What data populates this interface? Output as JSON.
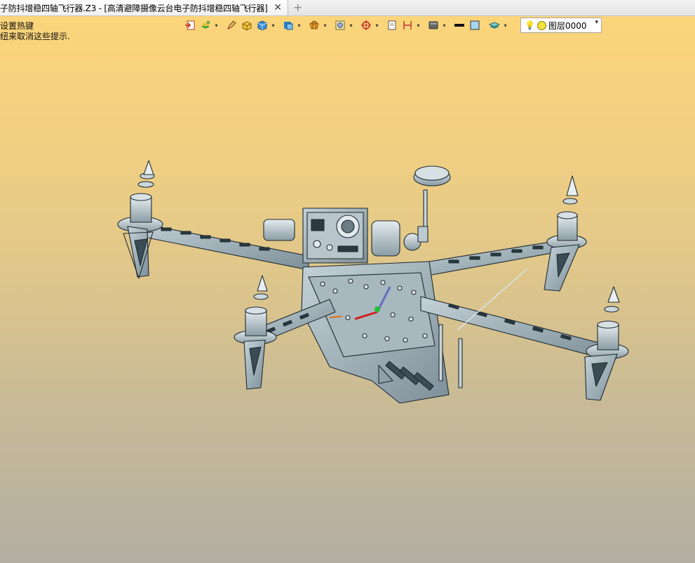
{
  "tab": {
    "title": "子防抖增稳四轴飞行器.Z3 - [高清避障摄像云台电子防抖增稳四轴飞行器]",
    "close_icon": "close-icon",
    "new_tab_label": "+"
  },
  "hints": {
    "line1": "设置热键",
    "line2": "纽来取消这些提示."
  },
  "toolbar": {
    "icons": [
      "import-icon",
      "layers-style-icon",
      "pencil-icon",
      "box-solid-icon",
      "cube-view-icon",
      "display-cube-icon",
      "section-view-icon",
      "render-mode-icon",
      "snap-target-icon",
      "frame-icon",
      "dimension-icon",
      "screen-icon",
      "line-color-icon",
      "face-color-icon",
      "layer-manager-icon"
    ]
  },
  "layer": {
    "bulb_icon": "lightbulb-icon",
    "name": "图层0000",
    "color": "#f2e23a"
  },
  "model": {
    "subject": "quadcopter-drone-model",
    "body_color": "#9fb0b8",
    "edge_color": "#1e2a30"
  }
}
